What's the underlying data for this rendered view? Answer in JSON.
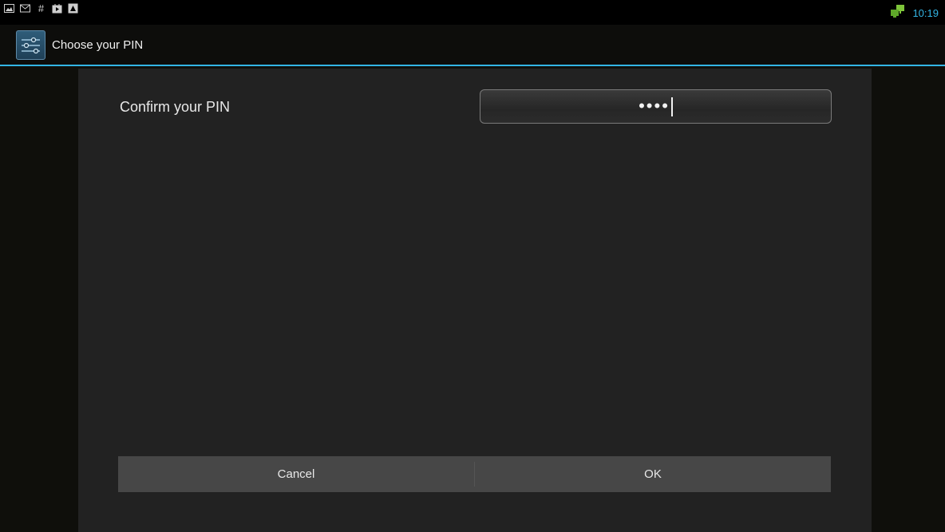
{
  "status_bar": {
    "left_icons": [
      "image-notification-icon",
      "gmail-notification-icon",
      "hashtag-notification-icon",
      "play-store-notification-icon",
      "photo-notification-icon"
    ],
    "network_icon": "network-connected-icon",
    "time": "10:19"
  },
  "action_bar": {
    "app_icon": "settings-icon",
    "title": "Choose your PIN"
  },
  "dialog": {
    "prompt": "Confirm your PIN",
    "pin_value": "••••",
    "cancel_label": "Cancel",
    "ok_label": "OK"
  },
  "colors": {
    "accent": "#33b5e5",
    "dialog_bg": "#222222",
    "button_bg": "#474747"
  }
}
